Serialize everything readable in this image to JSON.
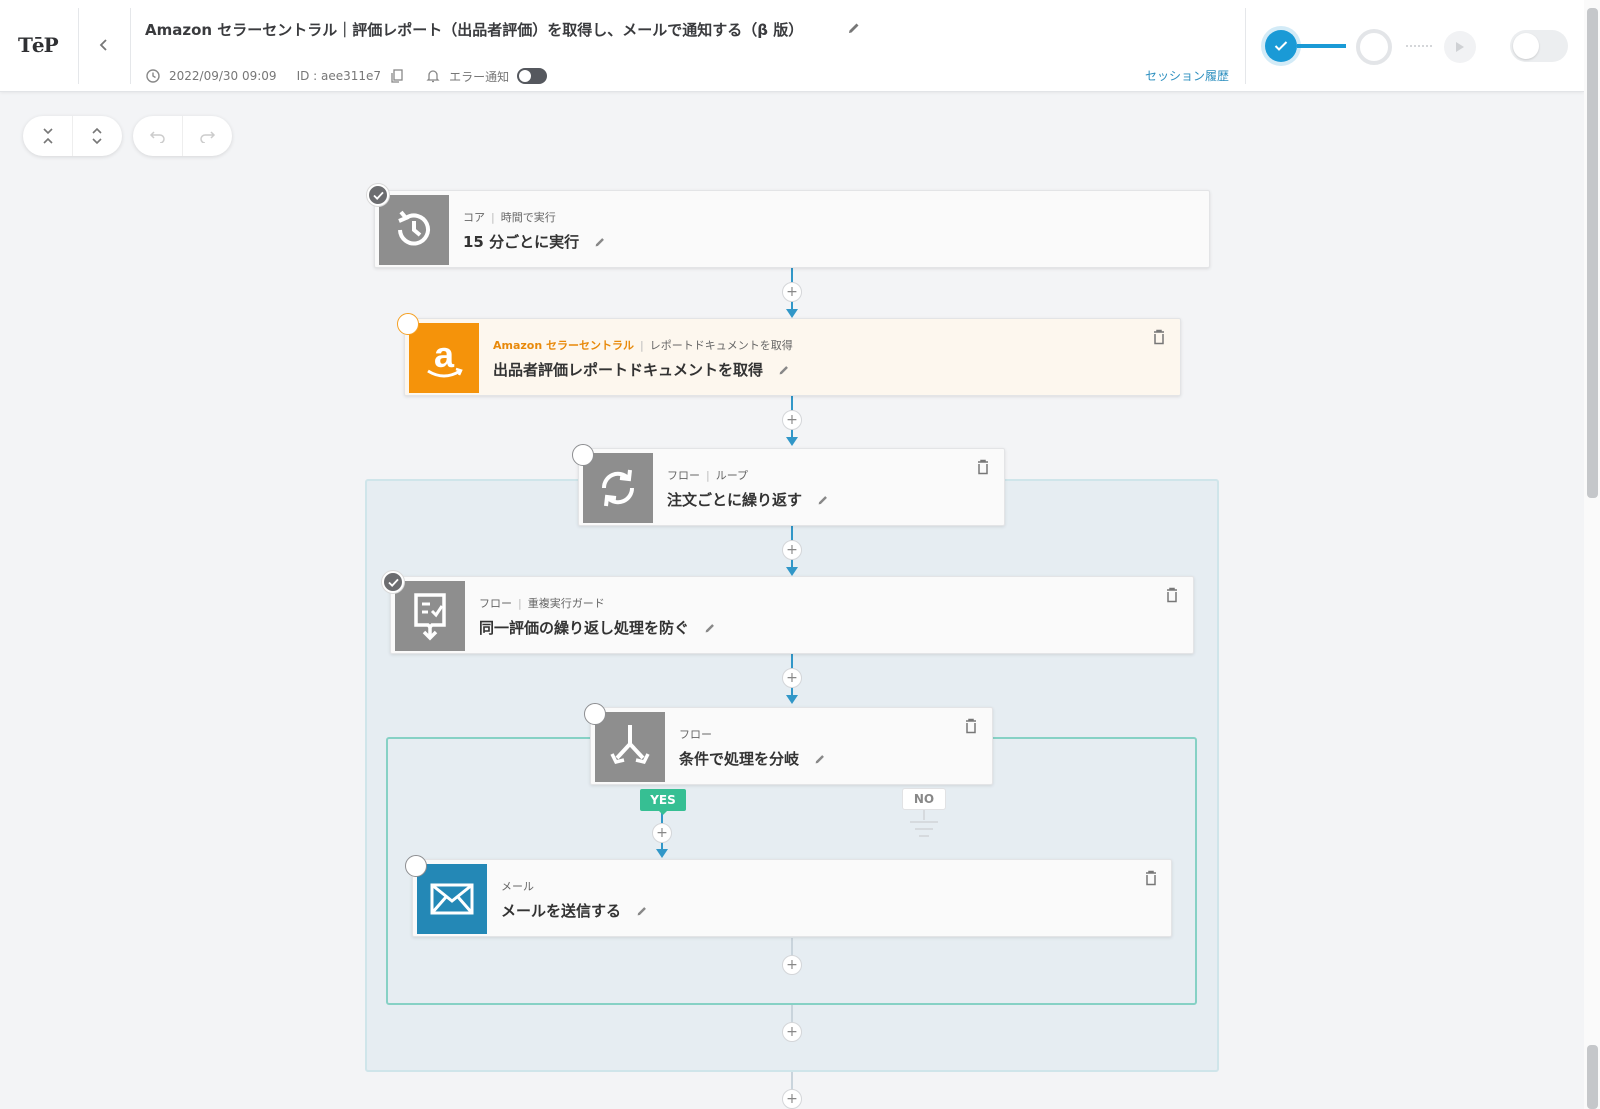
{
  "header": {
    "logo": "TēP",
    "title": "Amazon セラーセントラル｜評価レポート（出品者評価）を取得し、メールで通知する（β 版）",
    "timestamp": "2022/09/30 09:09",
    "id_text": "ID : aee311e7",
    "error_notify_label": "エラー通知",
    "session_history_label": "セッション履歴"
  },
  "nodes": [
    {
      "category": "コア",
      "subcategory": "時間で実行",
      "name": "15 分ごとに実行",
      "icon": "clock-rotate-icon",
      "status": "done"
    },
    {
      "category": "Amazon セラーセントラル",
      "subcategory": "レポートドキュメントを取得",
      "name": "出品者評価レポートドキュメントを取得",
      "icon": "amazon-logo-icon",
      "status": "empty"
    },
    {
      "category": "フロー",
      "subcategory": "ループ",
      "name": "注文ごとに繰り返す",
      "icon": "loop-arrows-icon",
      "status": "empty"
    },
    {
      "category": "フロー",
      "subcategory": "重複実行ガード",
      "name": "同一評価の繰り返し処理を防ぐ",
      "icon": "guard-check-icon",
      "status": "done"
    },
    {
      "category": "フロー",
      "subcategory": "",
      "name": "条件で処理を分岐",
      "icon": "branch-arrows-icon",
      "status": "empty"
    },
    {
      "category": "メール",
      "subcategory": "",
      "name": "メールを送信する",
      "icon": "envelope-icon",
      "status": "empty"
    }
  ],
  "branch": {
    "yes_label": "YES",
    "no_label": "NO"
  },
  "plus_label": "+",
  "colors": {
    "accent": "#1a9ad6",
    "connector": "#3197c8",
    "yes": "#36bf93",
    "amazon": "#f5930a",
    "mail": "#2488b6"
  }
}
